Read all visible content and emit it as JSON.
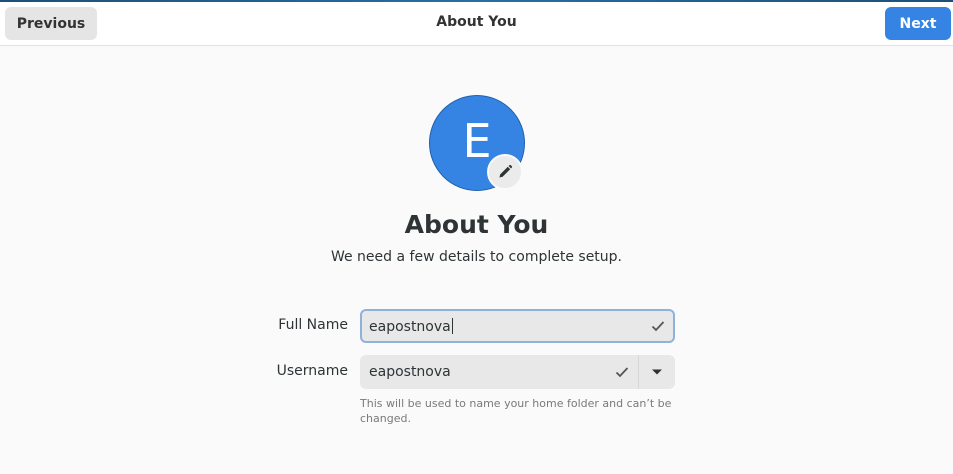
{
  "header": {
    "previous_label": "Previous",
    "title": "About You",
    "next_label": "Next"
  },
  "avatar": {
    "initial": "E",
    "color": "#3584e4"
  },
  "page": {
    "title": "About You",
    "subtitle": "We need a few details to complete setup."
  },
  "form": {
    "fullname_label": "Full Name",
    "fullname_value": "eapostnova",
    "username_label": "Username",
    "username_value": "eapostnova",
    "username_hint": "This will be used to name your home folder and can’t be changed."
  },
  "colors": {
    "accent": "#3584e4",
    "field_focus_border": "#8fb2dd"
  },
  "icons": {
    "edit": "pencil-icon",
    "valid": "check-icon",
    "dropdown": "chevron-down-icon"
  }
}
